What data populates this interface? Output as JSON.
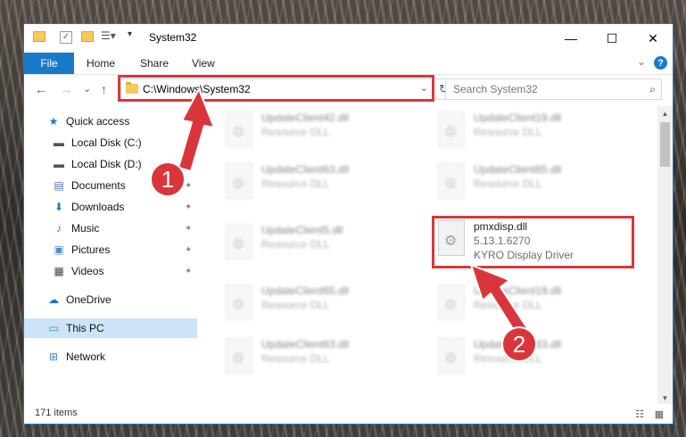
{
  "window": {
    "title": "System32",
    "controls": {
      "minimize": "—",
      "maximize": "☐",
      "close": "✕"
    }
  },
  "ribbon": {
    "tabs": [
      "File",
      "Home",
      "Share",
      "View"
    ],
    "expand_glyph": "⌄",
    "help_glyph": "?"
  },
  "navigation": {
    "back": "←",
    "forward": "→",
    "recent": "⌄",
    "up": "↑",
    "address": "C:\\Windows\\System32",
    "address_dropdown": "⌄",
    "refresh": "↻",
    "search_placeholder": "Search System32",
    "search_icon": "⌕"
  },
  "sidebar": {
    "items": [
      {
        "label": "Quick access",
        "icon": "star-icon",
        "glyph": "★",
        "color": "#1979ca",
        "pinned": false,
        "selected": false
      },
      {
        "label": "Local Disk (C:)",
        "icon": "drive-icon",
        "glyph": "▬",
        "color": "#555555",
        "pinned": false,
        "selected": false
      },
      {
        "label": "Local Disk (D:)",
        "icon": "drive-icon",
        "glyph": "▬",
        "color": "#555555",
        "pinned": true,
        "selected": false
      },
      {
        "label": "Documents",
        "icon": "documents-icon",
        "glyph": "▤",
        "color": "#4a73a8",
        "pinned": true,
        "selected": false
      },
      {
        "label": "Downloads",
        "icon": "downloads-icon",
        "glyph": "⬇",
        "color": "#1979ca",
        "pinned": true,
        "selected": false
      },
      {
        "label": "Music",
        "icon": "music-icon",
        "glyph": "♪",
        "color": "#1979ca",
        "pinned": true,
        "selected": false
      },
      {
        "label": "Pictures",
        "icon": "pictures-icon",
        "glyph": "▣",
        "color": "#4a8ac8",
        "pinned": true,
        "selected": false
      },
      {
        "label": "Videos",
        "icon": "videos-icon",
        "glyph": "▦",
        "color": "#444444",
        "pinned": true,
        "selected": false
      },
      {
        "label": "OneDrive",
        "icon": "cloud-icon",
        "glyph": "☁",
        "color": "#1979ca",
        "pinned": false,
        "selected": false
      },
      {
        "label": "This PC",
        "icon": "computer-icon",
        "glyph": "▭",
        "color": "#3a8bd0",
        "pinned": false,
        "selected": true
      },
      {
        "label": "Network",
        "icon": "network-icon",
        "glyph": "⊞",
        "color": "#3a8bd0",
        "pinned": false,
        "selected": false
      }
    ],
    "pin_glyph": "📌"
  },
  "files": [
    {
      "name": "UpdateClient42.dll",
      "desc": "Resource DLL",
      "blurred": true
    },
    {
      "name": "UpdateClient19.dll",
      "desc": "Resource DLL",
      "blurred": true
    },
    {
      "name": "UpdateClient63.dll",
      "desc": "Resource DLL",
      "blurred": true
    },
    {
      "name": "UpdateClient65.dll",
      "desc": "Resource DLL",
      "blurred": true
    },
    {
      "name": "UpdateClient5.dll",
      "desc": "Resource DLL",
      "blurred": true
    },
    {
      "name": "pmxdisp.dll",
      "desc": "5.13.1.6270",
      "sub": "KYRO Display Driver",
      "blurred": false
    },
    {
      "name": "UpdateClient65.dll",
      "desc": "Resource DLL",
      "blurred": true
    },
    {
      "name": "UpdateClient19.dll",
      "desc": "Resource DLL",
      "blurred": true
    },
    {
      "name": "UpdateClient63.dll",
      "desc": "Resource DLL",
      "blurred": true
    },
    {
      "name": "UpdateClient63.dll",
      "desc": "Resource DLL",
      "blurred": true
    }
  ],
  "status": {
    "count": "171 items",
    "details_view": "☷",
    "tiles_view": "▦"
  },
  "scrollbar": {
    "up": "▲",
    "down": "▼"
  },
  "callouts": {
    "one": "1",
    "two": "2",
    "color": "#d9363b"
  }
}
